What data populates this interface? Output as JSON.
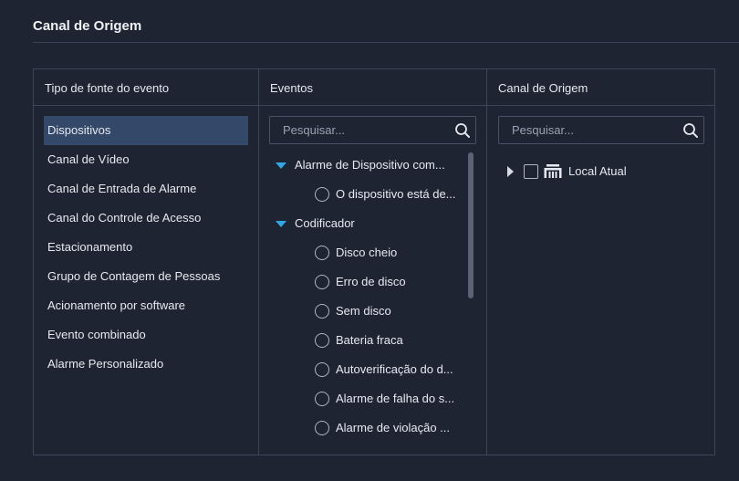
{
  "page": {
    "title": "Canal de Origem"
  },
  "source_types": {
    "header": "Tipo de fonte do evento",
    "items": [
      {
        "label": "Dispositivos",
        "selected": true
      },
      {
        "label": "Canal de Vídeo"
      },
      {
        "label": "Canal de Entrada de Alarme"
      },
      {
        "label": "Canal do Controle de Acesso"
      },
      {
        "label": "Estacionamento"
      },
      {
        "label": "Grupo de Contagem de Pessoas"
      },
      {
        "label": "Acionamento por software"
      },
      {
        "label": "Evento combinado"
      },
      {
        "label": "Alarme Personalizado"
      }
    ]
  },
  "events": {
    "header": "Eventos",
    "search_placeholder": "Pesquisar...",
    "groups": [
      {
        "label": "Alarme de Dispositivo com...",
        "items": [
          "O dispositivo está de..."
        ]
      },
      {
        "label": "Codificador",
        "items": [
          "Disco cheio",
          "Erro de disco",
          "Sem disco",
          "Bateria fraca",
          "Autoverificação do d...",
          "Alarme de falha do s...",
          "Alarme de violação ..."
        ]
      }
    ]
  },
  "channels": {
    "header": "Canal de Origem",
    "search_placeholder": "Pesquisar...",
    "root": {
      "label": "Local Atual",
      "icon": "device-group-icon"
    }
  },
  "colors": {
    "accent": "#2ea8e6",
    "selected_bg": "#34496a",
    "background": "#1f2433"
  }
}
